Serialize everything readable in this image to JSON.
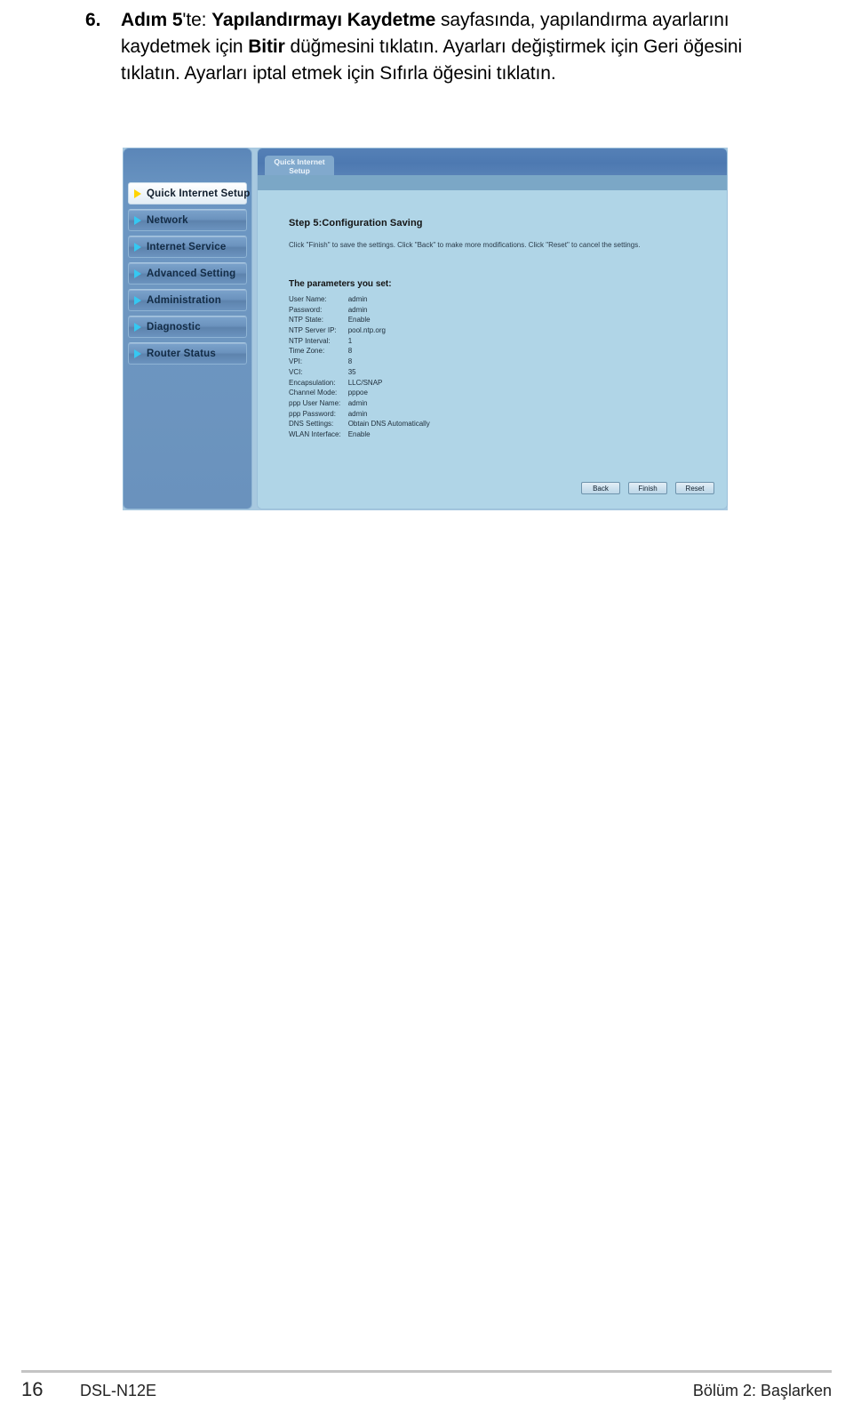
{
  "instruction": {
    "number": "6.",
    "segments": [
      {
        "text": "Adım 5",
        "bold": true
      },
      {
        "text": "'te: ",
        "bold": false
      },
      {
        "text": "Yapılandırmayı Kaydetme",
        "bold": true
      },
      {
        "text": " sayfasında, yapılandırma ayarlarını kaydetmek için ",
        "bold": false
      },
      {
        "text": "Bitir",
        "bold": true
      },
      {
        "text": " düğmesini tıklatın. Ayarları değiştirmek için Geri öğesini tıklatın. Ayarları iptal etmek için Sıfırla öğesini tıklatın.",
        "bold": false
      }
    ]
  },
  "router_ui": {
    "sidebar": {
      "items": [
        {
          "label": "Quick Internet Setup",
          "active": true,
          "icon": "arrow-right-icon"
        },
        {
          "label": "Network",
          "active": false,
          "icon": "arrow-right-icon"
        },
        {
          "label": "Internet Service",
          "active": false,
          "icon": "arrow-right-icon"
        },
        {
          "label": "Advanced Setting",
          "active": false,
          "icon": "arrow-right-icon"
        },
        {
          "label": "Administration",
          "active": false,
          "icon": "arrow-right-icon"
        },
        {
          "label": "Diagnostic",
          "active": false,
          "icon": "arrow-right-icon"
        },
        {
          "label": "Router Status",
          "active": false,
          "icon": "arrow-right-icon"
        }
      ]
    },
    "tab": {
      "label": "Quick Internet Setup"
    },
    "content": {
      "step_title": "Step 5:Configuration Saving",
      "description": "Click \"Finish\" to save the settings. Click \"Back\" to make more modifications. Click \"Reset\" to cancel the settings.",
      "params_title": "The parameters you set:",
      "params": [
        {
          "key": "User Name:",
          "value": "admin"
        },
        {
          "key": "Password:",
          "value": "admin"
        },
        {
          "key": "NTP State:",
          "value": "Enable"
        },
        {
          "key": "NTP Server IP:",
          "value": "pool.ntp.org"
        },
        {
          "key": "NTP Interval:",
          "value": "1"
        },
        {
          "key": "Time Zone:",
          "value": "8"
        },
        {
          "key": "VPI:",
          "value": "8"
        },
        {
          "key": "VCI:",
          "value": "35"
        },
        {
          "key": "Encapsulation:",
          "value": "LLC/SNAP"
        },
        {
          "key": "Channel Mode:",
          "value": "pppoe"
        },
        {
          "key": "ppp User Name:",
          "value": "admin"
        },
        {
          "key": "ppp Password:",
          "value": "admin"
        },
        {
          "key": "DNS Settings:",
          "value": "Obtain DNS Automatically"
        },
        {
          "key": "WLAN Interface:",
          "value": "Enable"
        }
      ],
      "buttons": [
        {
          "label": "Back"
        },
        {
          "label": "Finish"
        },
        {
          "label": "Reset"
        }
      ]
    },
    "colors": {
      "sidebar_blue": "#6a93be",
      "tabbar_blue": "#4d79b1",
      "body_blue": "#b0d5e7",
      "accent_arrow": "#35c8f2",
      "active_arrow": "#ffd400"
    }
  },
  "footer": {
    "page_number": "16",
    "document": "DSL-N12E",
    "chapter": "Bölüm 2: Başlarken"
  }
}
